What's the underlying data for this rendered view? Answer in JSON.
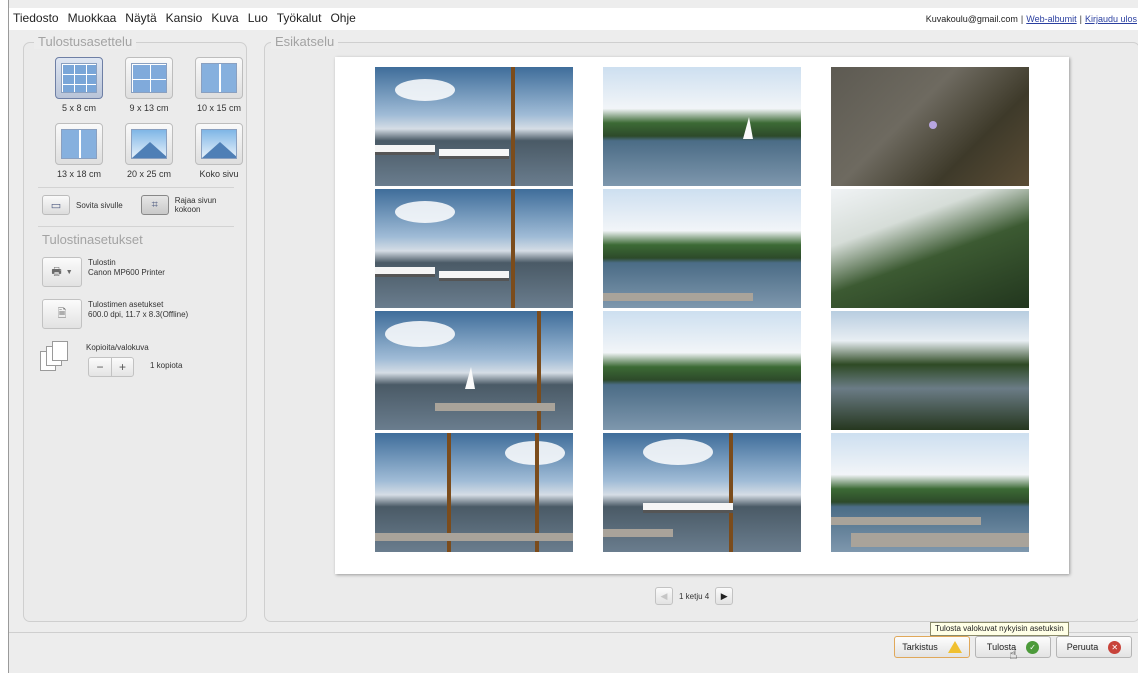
{
  "menu": [
    "Tiedosto",
    "Muokkaa",
    "Näytä",
    "Kansio",
    "Kuva",
    "Luo",
    "Työkalut",
    "Ohje"
  ],
  "account": {
    "email": "Kuvakoulu@gmail.com",
    "web_albums": "Web-albumit",
    "logout": "Kirjaudu ulos"
  },
  "layout_panel": {
    "title": "Tulostusasettelu",
    "sizes": [
      {
        "label": "5 x 8 cm",
        "icon": "grid-8-icon",
        "selected": true
      },
      {
        "label": "9 x 13 cm",
        "icon": "grid-4-icon",
        "selected": false
      },
      {
        "label": "10 x 15 cm",
        "icon": "grid-2-icon",
        "selected": false
      },
      {
        "label": "13 x 18 cm",
        "icon": "grid-2-icon",
        "selected": false
      },
      {
        "label": "20 x 25 cm",
        "icon": "mountain-icon",
        "selected": false
      },
      {
        "label": "Koko sivu",
        "icon": "mountain-icon",
        "selected": false
      }
    ],
    "fit_page_label": "Sovita sivulle",
    "crop_label_line1": "Rajaa sivun",
    "crop_label_line2": "kokoon"
  },
  "printer_settings": {
    "title": "Tulostinasetukset",
    "printer_label": "Tulostin",
    "printer_name": "Canon MP600 Printer",
    "printer_settings_label": "Tulostimen asetukset",
    "printer_settings_value": "600.0 dpi, 11.7 x 8.3(Offline)",
    "copies_label": "Kopioita/valokuva",
    "copies_minus": "−",
    "copies_plus": "+",
    "copies_value": "1 kopiota"
  },
  "preview": {
    "title": "Esikatselu",
    "photos": [
      "harbor",
      "lake",
      "ground",
      "harbor",
      "lake",
      "pine",
      "harbor",
      "lake",
      "forest",
      "harbor",
      "harbor",
      "lake"
    ],
    "page_label": "1 ketju 4"
  },
  "tooltip": "Tulosta valokuvat nykyisin asetuksin",
  "buttons": {
    "check": "Tarkistus",
    "print": "Tulosta",
    "cancel": "Peruuta"
  },
  "colors": {
    "accent_warning": "#f0c030",
    "accent_ok": "#4c9a3a",
    "accent_cancel": "#c8433a",
    "link": "#2a3fa0"
  }
}
